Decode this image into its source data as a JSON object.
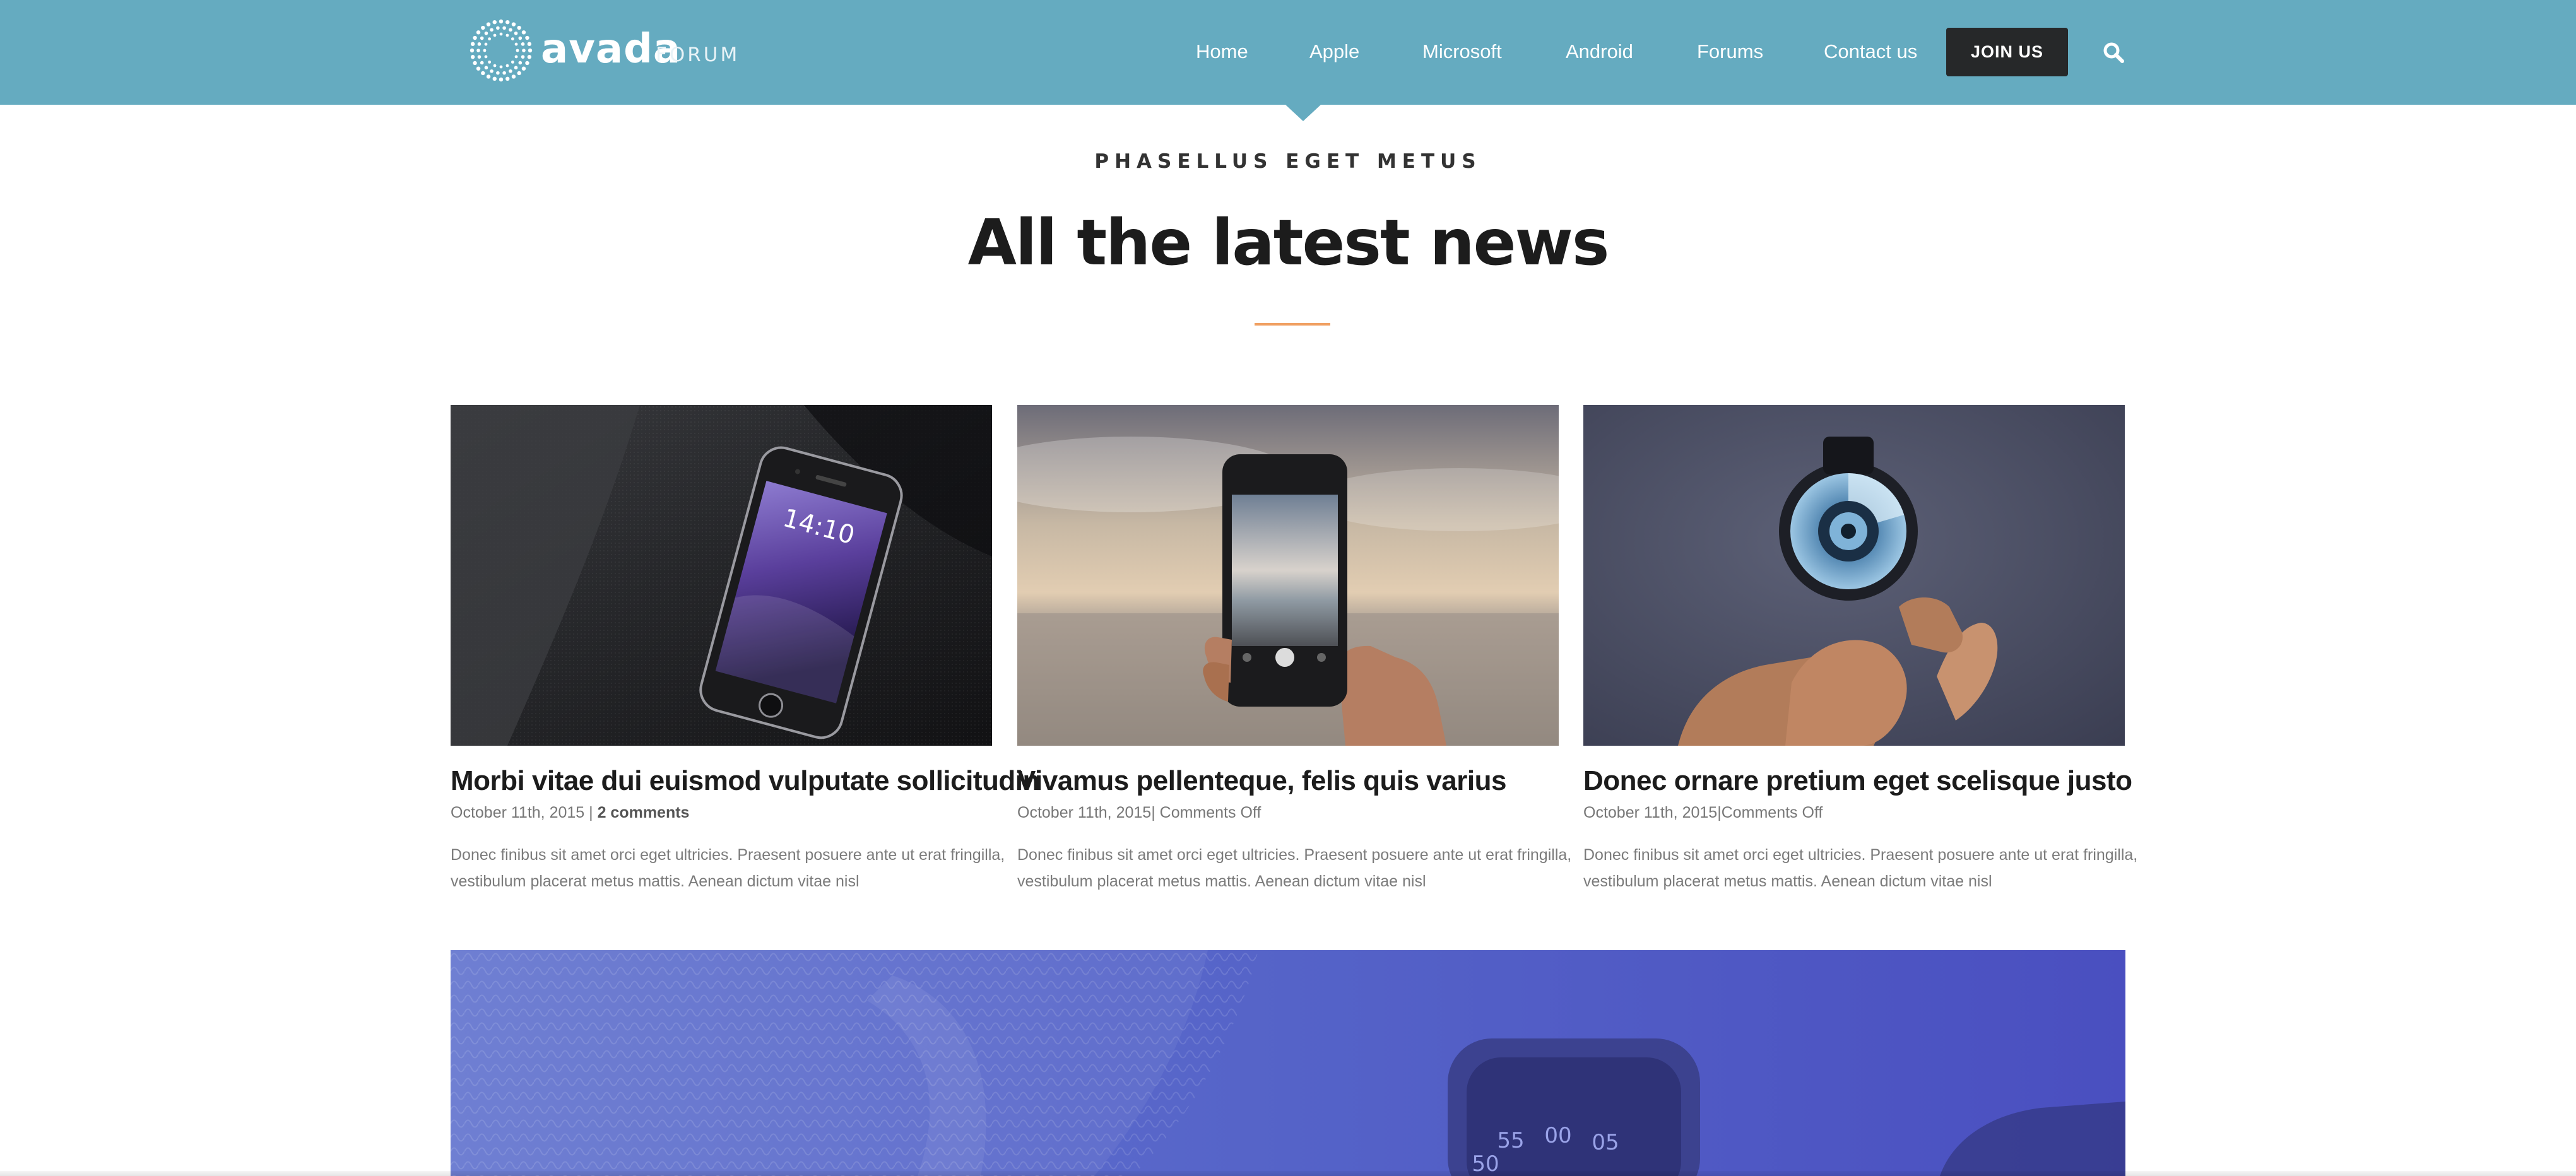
{
  "header": {
    "logo": {
      "word": "avada",
      "sub": "FORUM"
    },
    "nav": [
      {
        "label": "Home"
      },
      {
        "label": "Apple"
      },
      {
        "label": "Microsoft"
      },
      {
        "label": "Android"
      },
      {
        "label": "Forums"
      },
      {
        "label": "Contact us"
      }
    ],
    "join_label": "JOIN US",
    "icons": {
      "search": "search-icon",
      "logo": "sunburst-logo-icon"
    },
    "colors": {
      "bar": "#65abc0",
      "join_bg": "#262829"
    }
  },
  "section": {
    "eyebrow": "PHASELLUS EGET METUS",
    "title": "All the latest news",
    "rule_color": "#f0a062"
  },
  "posts": [
    {
      "title": "Morbi vitae dui euismod vulputate sollicitudin",
      "date": "October 11th, 2015",
      "separator": " | ",
      "comments": "2 comments",
      "excerpt": "Donec finibus sit amet orci eget ultricies. Praesent posuere ante ut erat fringilla, vestibulum placerat metus mattis. Aenean dictum vitae nisl",
      "image": "phone-on-fabric",
      "phone_time": "14:10"
    },
    {
      "title": "Vivamus pellenteque, felis quis varius",
      "date": "October 11th, 2015",
      "separator": "| ",
      "comments": "Comments Off",
      "excerpt": "Donec finibus sit amet orci eget ultricies. Praesent posuere ante ut erat fringilla, vestibulum placerat metus mattis. Aenean dictum vitae nisl",
      "image": "phone-photographing-sea"
    },
    {
      "title": "Donec ornare pretium eget scelisque justo",
      "date": "October 11th, 2015",
      "separator": "|",
      "comments": "Comments Off",
      "excerpt": "Donec finibus sit amet orci eget ultricies. Praesent posuere ante ut erat fringilla, vestibulum placerat metus mattis. Aenean dictum vitae nisl",
      "image": "hand-holding-watch"
    }
  ],
  "banner": {
    "image": "smartwatch-on-blue",
    "dial": [
      "55",
      "00",
      "05",
      "50"
    ]
  }
}
